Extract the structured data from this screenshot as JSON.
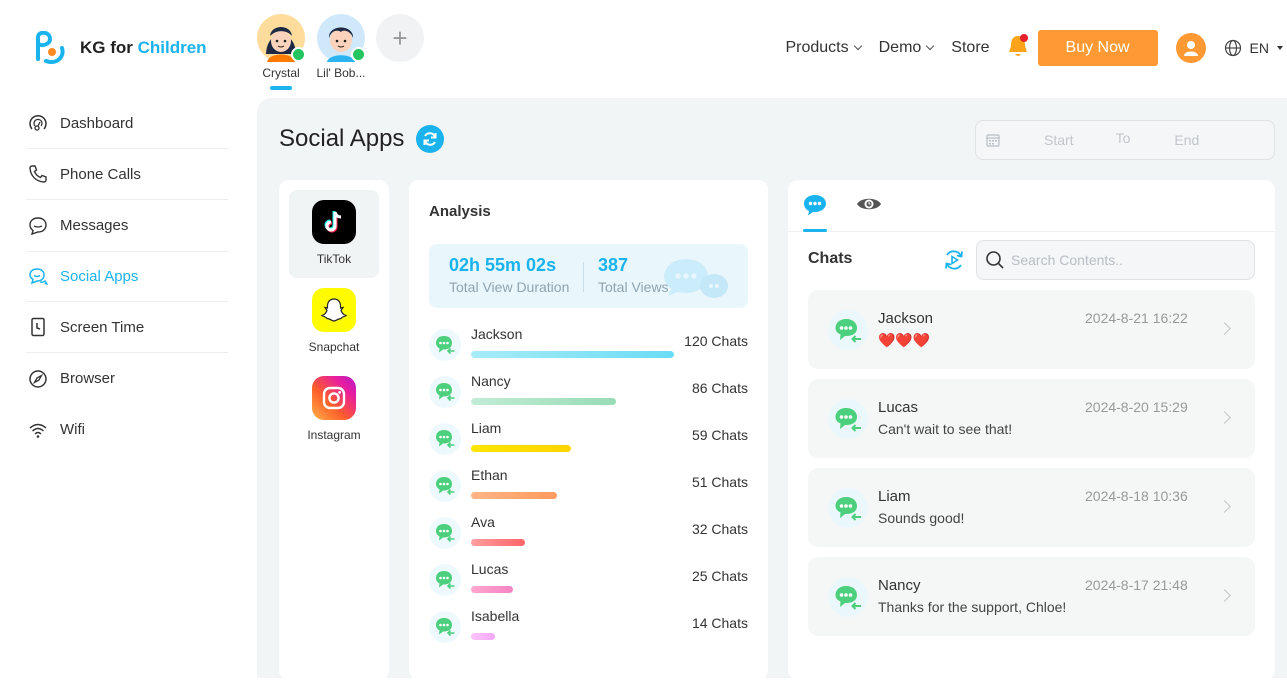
{
  "brand": {
    "name_prefix": "KG for ",
    "name_highlight": "Children"
  },
  "kids": [
    {
      "name": "Crystal",
      "online": true,
      "active": true
    },
    {
      "name": "Lil' Bob...",
      "online": true,
      "active": false
    }
  ],
  "topnav": {
    "products": "Products",
    "demo": "Demo",
    "store": "Store",
    "buy_now": "Buy Now",
    "language": "EN"
  },
  "sidebar": {
    "items": [
      {
        "label": "Dashboard",
        "icon": "dashboard-icon"
      },
      {
        "label": "Phone Calls",
        "icon": "phone-icon"
      },
      {
        "label": "Messages",
        "icon": "message-icon"
      },
      {
        "label": "Social Apps",
        "icon": "social-apps-icon",
        "active": true
      },
      {
        "label": "Screen Time",
        "icon": "screen-time-icon"
      },
      {
        "label": "Browser",
        "icon": "compass-icon"
      },
      {
        "label": "Wifi",
        "icon": "wifi-icon"
      }
    ]
  },
  "page": {
    "title": "Social Apps",
    "date_range": {
      "start": "Start",
      "to": "To",
      "end": "End"
    }
  },
  "apps": [
    {
      "label": "TikTok",
      "active": true
    },
    {
      "label": "Snapchat"
    },
    {
      "label": "Instagram"
    }
  ],
  "analysis": {
    "title": "Analysis",
    "total_view_duration": "02h 55m 02s",
    "total_view_duration_label": "Total View Duration",
    "total_views": "387",
    "total_views_label": "Total Views",
    "ranking": [
      {
        "name": "Jackson",
        "count": 120,
        "count_label": "120 Chats",
        "color_from": "#a8ecf8",
        "color_to": "#6adcf5"
      },
      {
        "name": "Nancy",
        "count": 86,
        "count_label": "86 Chats",
        "color_from": "#c2ecd6",
        "color_to": "#98dcb6"
      },
      {
        "name": "Liam",
        "count": 59,
        "count_label": "59 Chats",
        "color_from": "#ffe600",
        "color_to": "#ffd400"
      },
      {
        "name": "Ethan",
        "count": 51,
        "count_label": "51 Chats",
        "color_from": "#ffb487",
        "color_to": "#ff9a5c"
      },
      {
        "name": "Ava",
        "count": 32,
        "count_label": "32 Chats",
        "color_from": "#ff9ea0",
        "color_to": "#ff6468"
      },
      {
        "name": "Lucas",
        "count": 25,
        "count_label": "25 Chats",
        "color_from": "#ffa6cf",
        "color_to": "#f584c4"
      },
      {
        "name": "Isabella",
        "count": 14,
        "count_label": "14 Chats",
        "color_from": "#fbc4fb",
        "color_to": "#f4a8f6"
      }
    ]
  },
  "chats": {
    "title": "Chats",
    "search_placeholder": "Search Contents..",
    "search_value": "",
    "items": [
      {
        "name": "Jackson",
        "message": "❤️❤️❤️",
        "time": "2024-8-21 16:22"
      },
      {
        "name": "Lucas",
        "message": "Can't wait to see that!",
        "time": "2024-8-20 15:29"
      },
      {
        "name": "Liam",
        "message": "Sounds good!",
        "time": "2024-8-18 10:36"
      },
      {
        "name": "Nancy",
        "message": "Thanks for the support, Chloe!",
        "time": "2024-8-17 21:48"
      }
    ]
  },
  "colors": {
    "accent": "#1ab3ee",
    "orange": "#ff9933",
    "green": "#4cd07d"
  }
}
